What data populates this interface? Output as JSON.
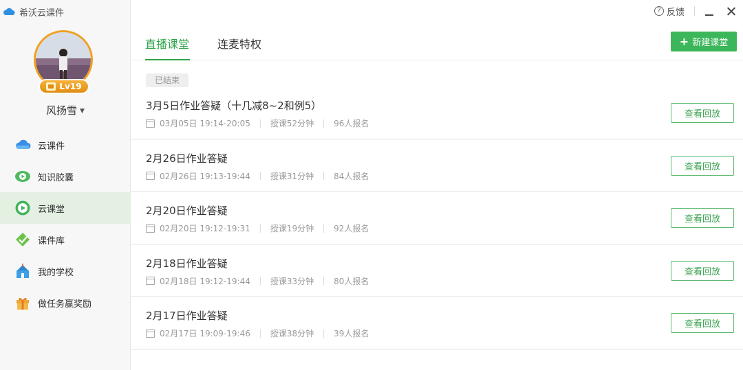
{
  "app": {
    "title": "希沃云课件",
    "logo_icon": "cloud-icon"
  },
  "user": {
    "name": "风扬雪",
    "level": "Lv19"
  },
  "sidebar": {
    "items": [
      {
        "label": "云课件",
        "icon": "cloud-icon",
        "active": false
      },
      {
        "label": "知识胶囊",
        "icon": "capsule-icon",
        "active": false
      },
      {
        "label": "云课堂",
        "icon": "play-circle-icon",
        "active": true
      },
      {
        "label": "课件库",
        "icon": "library-icon",
        "active": false
      },
      {
        "label": "我的学校",
        "icon": "school-icon",
        "active": false
      },
      {
        "label": "做任务赢奖励",
        "icon": "gift-icon",
        "active": false
      }
    ]
  },
  "window": {
    "feedback_label": "反馈"
  },
  "tabs": [
    {
      "label": "直播课堂",
      "active": true
    },
    {
      "label": "连麦特权",
      "active": false
    }
  ],
  "toolbar": {
    "new_label": "新建课堂"
  },
  "list": {
    "status_tag": "已结束",
    "replay_label": "查看回放",
    "items": [
      {
        "title": "3月5日作业答疑（十几减8~2和例5）",
        "time": "03月05日 19:14-20:05",
        "duration": "授课52分钟",
        "signups": "96人报名"
      },
      {
        "title": "2月26日作业答疑",
        "time": "02月26日 19:13-19:44",
        "duration": "授课31分钟",
        "signups": "84人报名"
      },
      {
        "title": "2月20日作业答疑",
        "time": "02月20日 19:12-19:31",
        "duration": "授课19分钟",
        "signups": "92人报名"
      },
      {
        "title": "2月18日作业答疑",
        "time": "02月18日 19:12-19:44",
        "duration": "授课33分钟",
        "signups": "80人报名"
      },
      {
        "title": "2月17日作业答疑",
        "time": "02月17日 19:09-19:46",
        "duration": "授课38分钟",
        "signups": "39人报名"
      }
    ]
  },
  "colors": {
    "accent": "#3cb65a",
    "level_badge": "#f0a022",
    "active_nav_bg": "#e3f0e2"
  }
}
